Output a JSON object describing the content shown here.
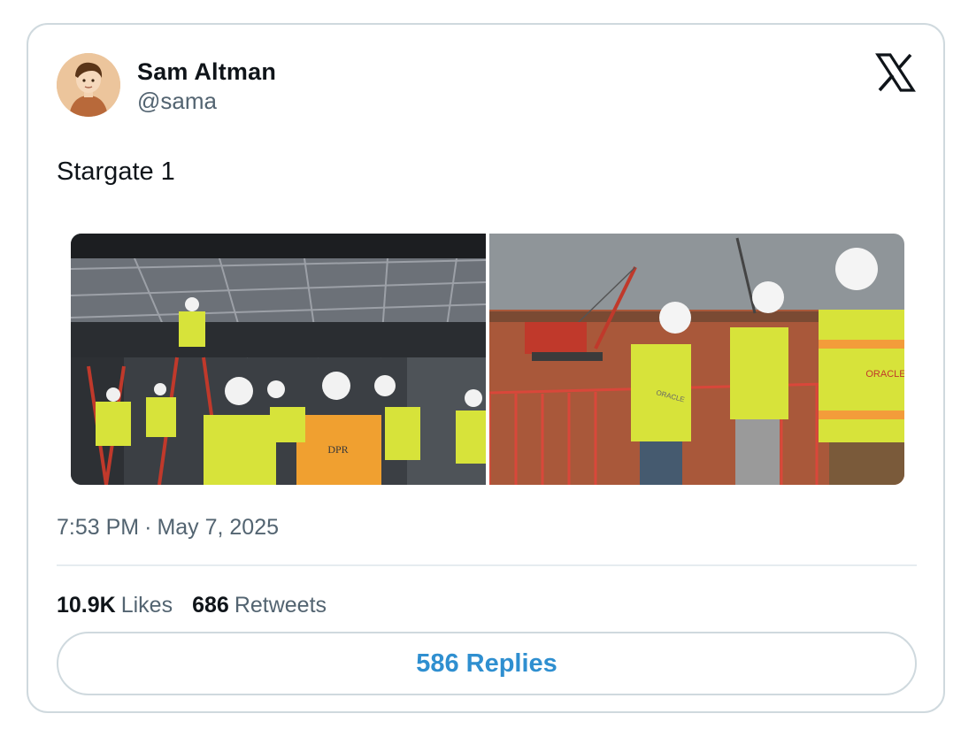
{
  "tweet": {
    "author_name": "Sam Altman",
    "author_handle": "@sama",
    "text": "Stargate 1",
    "time": "7:53 PM",
    "separator": "·",
    "date": "May 7, 2025",
    "likes_count": "10.9K",
    "likes_label": "Likes",
    "retweets_count": "686",
    "retweets_label": "Retweets",
    "replies_label": "586 Replies"
  },
  "icons": {
    "brand": "x-logo-icon",
    "avatar": "avatar-illustration"
  },
  "photos": {
    "left_vest_text_1": "DPR",
    "right_vest_text_1": "ORACLE",
    "right_vest_text_2": "ORACLE"
  },
  "colors": {
    "accent": "#1d9bf0",
    "secondary_text": "#536471",
    "border": "#cfd9de"
  }
}
